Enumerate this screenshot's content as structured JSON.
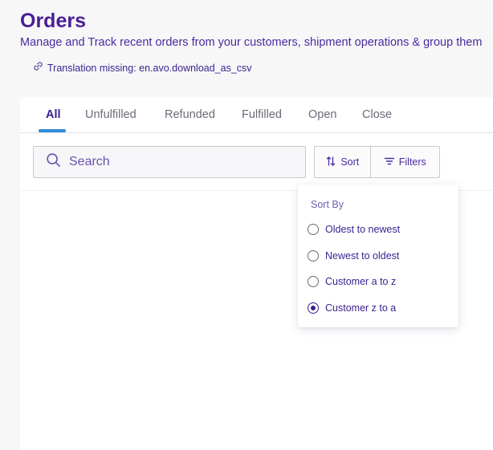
{
  "header": {
    "title": "Orders",
    "subtitle": "Manage and Track recent orders from your customers, shipment operations & group them",
    "csv_link_label": "Translation missing: en.avo.download_as_csv"
  },
  "tabs": [
    {
      "label": "All",
      "active": true
    },
    {
      "label": "Unfulfilled",
      "active": false
    },
    {
      "label": "Refunded",
      "active": false
    },
    {
      "label": "Fulfilled",
      "active": false
    },
    {
      "label": "Open",
      "active": false
    },
    {
      "label": "Close",
      "active": false
    }
  ],
  "search": {
    "placeholder": "Search",
    "value": ""
  },
  "toolbar": {
    "sort_label": "Sort",
    "filters_label": "Filters"
  },
  "sort_menu": {
    "title": "Sort By",
    "options": [
      {
        "label": "Oldest to newest",
        "selected": false
      },
      {
        "label": "Newest to oldest",
        "selected": false
      },
      {
        "label": "Customer a to z",
        "selected": false
      },
      {
        "label": "Customer z to a",
        "selected": true
      }
    ]
  },
  "colors": {
    "accent": "#3a1d8f",
    "tab_underline": "#2f8bd9",
    "title": "#4a1d96"
  },
  "icons": {
    "csv_link": "link-icon",
    "search": "search-icon",
    "sort": "sort-arrows-icon",
    "filters": "filter-icon"
  }
}
